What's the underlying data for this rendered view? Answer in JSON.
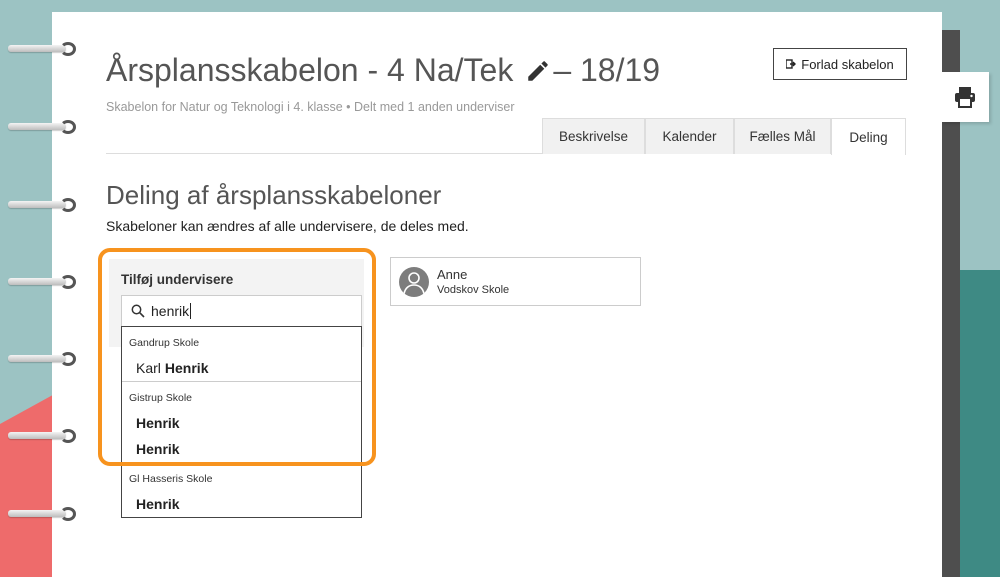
{
  "app": {
    "title": "Årsplansskabelon - 4 Na/Tek",
    "year": "– 18/19",
    "subtitle": "Skabelon for Natur og Teknologi i 4. klasse • Delt med 1 anden underviser",
    "leave_button": "Forlad skabelon"
  },
  "tabs": [
    {
      "label": "Beskrivelse"
    },
    {
      "label": "Kalender"
    },
    {
      "label": "Fælles Mål"
    },
    {
      "label": "Deling"
    }
  ],
  "sharing": {
    "heading": "Deling af årsplansskabeloner",
    "description": "Skabeloner kan ændres af alle undervisere, de deles med.",
    "add_label": "Tilføj undervisere",
    "search_value": "henrik",
    "groups": [
      {
        "school": "Gandrup Skole",
        "options": [
          {
            "plain": "Karl",
            "bold": "Henrik"
          }
        ]
      },
      {
        "school": "Gistrup Skole",
        "options": [
          {
            "plain": "",
            "bold": "Henrik"
          },
          {
            "plain": "",
            "bold": "Henrik"
          }
        ]
      },
      {
        "school": "Gl Hasseris Skole",
        "options": [
          {
            "plain": "",
            "bold": "Henrik"
          }
        ]
      }
    ],
    "shared_with": {
      "name": "Anne",
      "school": "Vodskov Skole"
    }
  },
  "colors": {
    "background": "#9cc3c3",
    "highlight": "#f7931e",
    "coral": "#ee6b6b",
    "teal": "#3e8a84"
  },
  "icons": [
    "pencil-icon",
    "exit-icon",
    "search-icon",
    "print-icon",
    "user-icon"
  ]
}
